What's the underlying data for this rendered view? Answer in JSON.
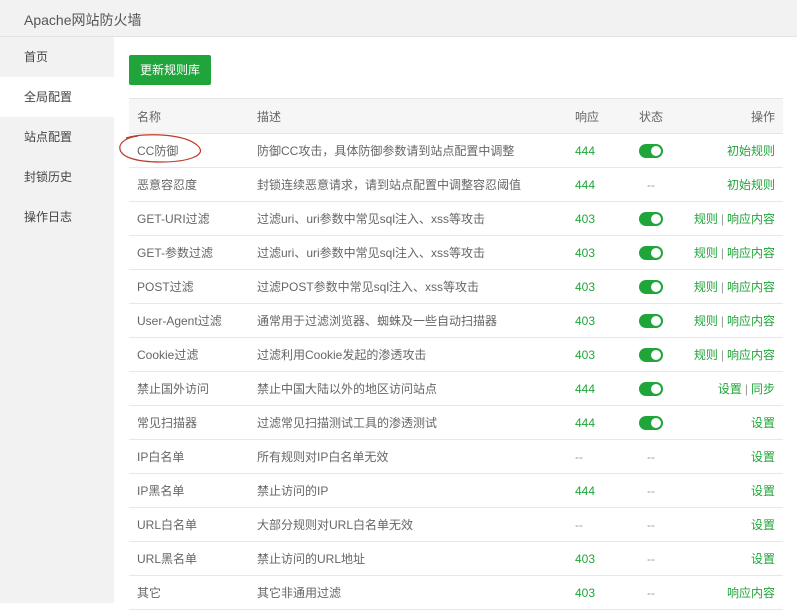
{
  "window": {
    "title": "Apache网站防火墙"
  },
  "sidebar": {
    "items": [
      {
        "label": "首页",
        "active": false
      },
      {
        "label": "全局配置",
        "active": true
      },
      {
        "label": "站点配置",
        "active": false
      },
      {
        "label": "封锁历史",
        "active": false
      },
      {
        "label": "操作日志",
        "active": false
      }
    ]
  },
  "toolbar": {
    "update_label": "更新规则库"
  },
  "table": {
    "headers": {
      "name": "名称",
      "desc": "描述",
      "code": "响应",
      "status": "状态",
      "ops": "操作"
    },
    "rows": [
      {
        "name": "CC防御",
        "desc": "防御CC攻击，具体防御参数请到站点配置中调整",
        "code": "444",
        "status": "on",
        "ops": [
          "初始规则"
        ]
      },
      {
        "name": "恶意容忍度",
        "desc": "封锁连续恶意请求，请到站点配置中调整容忍阈值",
        "code": "444",
        "status": "--",
        "ops": [
          "初始规则"
        ]
      },
      {
        "name": "GET-URI过滤",
        "desc": "过滤uri、uri参数中常见sql注入、xss等攻击",
        "code": "403",
        "status": "on",
        "ops": [
          "规则",
          "响应内容"
        ]
      },
      {
        "name": "GET-参数过滤",
        "desc": "过滤uri、uri参数中常见sql注入、xss等攻击",
        "code": "403",
        "status": "on",
        "ops": [
          "规则",
          "响应内容"
        ]
      },
      {
        "name": "POST过滤",
        "desc": "过滤POST参数中常见sql注入、xss等攻击",
        "code": "403",
        "status": "on",
        "ops": [
          "规则",
          "响应内容"
        ]
      },
      {
        "name": "User-Agent过滤",
        "desc": "通常用于过滤浏览器、蜘蛛及一些自动扫描器",
        "code": "403",
        "status": "on",
        "ops": [
          "规则",
          "响应内容"
        ]
      },
      {
        "name": "Cookie过滤",
        "desc": "过滤利用Cookie发起的渗透攻击",
        "code": "403",
        "status": "on",
        "ops": [
          "规则",
          "响应内容"
        ]
      },
      {
        "name": "禁止国外访问",
        "desc": "禁止中国大陆以外的地区访问站点",
        "code": "444",
        "status": "on",
        "ops": [
          "设置",
          "同步"
        ]
      },
      {
        "name": "常见扫描器",
        "desc": "过滤常见扫描测试工具的渗透测试",
        "code": "444",
        "status": "on",
        "ops": [
          "设置"
        ]
      },
      {
        "name": "IP白名单",
        "desc": "所有规则对IP白名单无效",
        "code": "--",
        "status": "--",
        "ops": [
          "设置"
        ]
      },
      {
        "name": "IP黑名单",
        "desc": "禁止访问的IP",
        "code": "444",
        "status": "--",
        "ops": [
          "设置"
        ]
      },
      {
        "name": "URL白名单",
        "desc": "大部分规则对URL白名单无效",
        "code": "--",
        "status": "--",
        "ops": [
          "设置"
        ]
      },
      {
        "name": "URL黑名单",
        "desc": "禁止访问的URL地址",
        "code": "403",
        "status": "--",
        "ops": [
          "设置"
        ]
      },
      {
        "name": "其它",
        "desc": "其它非通用过滤",
        "code": "403",
        "status": "--",
        "ops": [
          "响应内容"
        ]
      }
    ]
  },
  "colors": {
    "accent": "#20a53a",
    "annotation": "#c0392b"
  }
}
